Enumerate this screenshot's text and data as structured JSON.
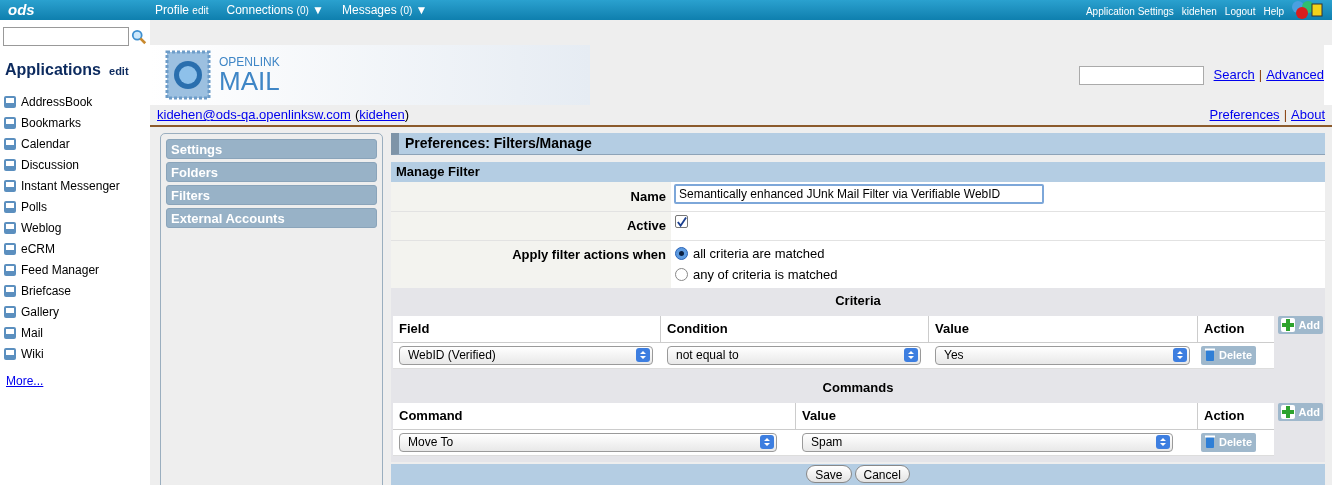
{
  "top_bar": {
    "logo": "ods",
    "nav": [
      {
        "label": "Profile",
        "extra": "edit"
      },
      {
        "label": "Connections",
        "extra": "(0)",
        "caret": "▼"
      },
      {
        "label": "Messages",
        "extra": "(0)",
        "caret": "▼"
      }
    ],
    "links": [
      "Application Settings",
      "kidehen",
      "Logout",
      "Help"
    ]
  },
  "sidebar": {
    "title": "Applications",
    "title_link": "edit",
    "apps": [
      "AddressBook",
      "Bookmarks",
      "Calendar",
      "Discussion",
      "Instant Messenger",
      "Polls",
      "Weblog",
      "eCRM",
      "Feed Manager",
      "Briefcase",
      "Gallery",
      "Mail",
      "Wiki"
    ],
    "more": "More..."
  },
  "banner": {
    "logo_top": "OPENLINK",
    "logo_bottom": "MAIL",
    "search_links": [
      "Search",
      "Advanced"
    ],
    "separator": "|"
  },
  "account": {
    "email": "kidehen@ods-qa.openlinksw.com",
    "open": "(",
    "user": "kidehen",
    "close": ")",
    "links": [
      "Preferences",
      "About"
    ],
    "separator": "|"
  },
  "nav_panel": [
    "Settings",
    "Folders",
    "Filters",
    "External Accounts"
  ],
  "content": {
    "title": "Preferences: Filters/Manage",
    "section": "Manage Filter",
    "name": {
      "label": "Name",
      "value": "Semantically enhanced JUnk Mail Filter via Verifiable WebID"
    },
    "active": {
      "label": "Active",
      "checked": true
    },
    "apply": {
      "label": "Apply filter actions when",
      "options": [
        {
          "label": "all criteria are matched",
          "selected": true
        },
        {
          "label": "any of criteria is matched",
          "selected": false
        }
      ]
    },
    "criteria": {
      "title": "Criteria",
      "columns": [
        "Field",
        "Condition",
        "Value",
        "Action"
      ],
      "add": "Add",
      "rows": [
        {
          "cells": [
            "WebID (Verified)",
            "not equal to",
            "Yes"
          ],
          "action": "Delete"
        }
      ]
    },
    "commands": {
      "title": "Commands",
      "columns": [
        "Command",
        "Value",
        "Action"
      ],
      "add": "Add",
      "rows": [
        {
          "cells": [
            "Move To",
            "Spam"
          ],
          "action": "Delete"
        }
      ]
    },
    "buttons": [
      "Save",
      "Cancel"
    ]
  }
}
